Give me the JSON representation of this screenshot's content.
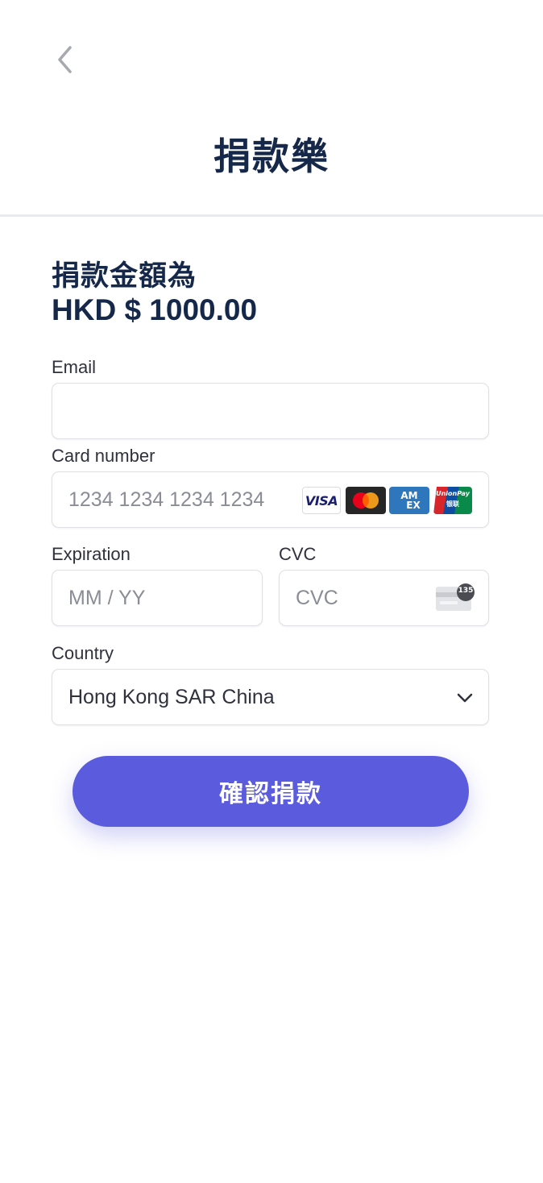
{
  "header": {
    "title": "捐款樂"
  },
  "donation": {
    "amount_label": "捐款金額為",
    "amount_value": "HKD $ 1000.00"
  },
  "form": {
    "email": {
      "label": "Email",
      "value": ""
    },
    "card_number": {
      "label": "Card number",
      "placeholder": "1234 1234 1234 1234",
      "brands": [
        "VISA",
        "Mastercard",
        "AMEX",
        "UnionPay"
      ]
    },
    "expiration": {
      "label": "Expiration",
      "placeholder": "MM / YY"
    },
    "cvc": {
      "label": "CVC",
      "placeholder": "CVC",
      "icon_text": "135"
    },
    "country": {
      "label": "Country",
      "value": "Hong Kong SAR China"
    }
  },
  "actions": {
    "confirm_label": "確認捐款"
  },
  "brand_text": {
    "visa": "VISA",
    "amex_top": "AM",
    "amex_bottom": "EX",
    "unionpay_top": "UnionPay",
    "unionpay_bottom": "银联"
  },
  "colors": {
    "accent": "#5b5bde",
    "title": "#16284a",
    "placeholder": "#8a8d95",
    "border": "#e0e0e4"
  },
  "icons": {
    "back": "chevron-left-icon",
    "dropdown": "chevron-down-icon",
    "cvc": "card-cvc-icon"
  }
}
